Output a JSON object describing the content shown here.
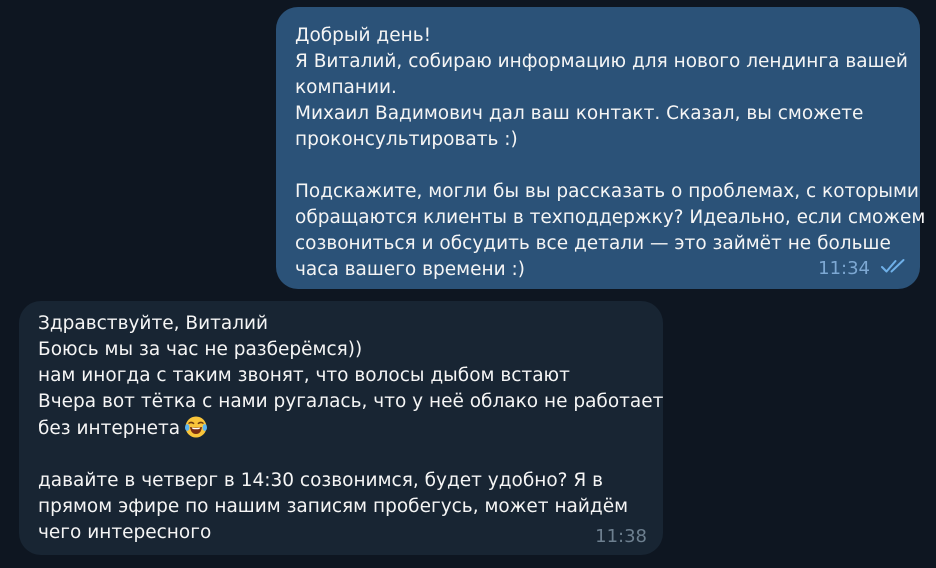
{
  "outgoing_message": {
    "lines": [
      "Добрый день!",
      "Я Виталий, собираю информацию для нового лендинга вашей",
      "компании.",
      "Михаил Вадимович дал ваш контакт. Сказал, вы сможете",
      "проконсультировать :)",
      "",
      "Подскажите, могли бы вы рассказать о проблемах, с которыми",
      "обращаются клиенты в техподдержку? Идеально, если сможем",
      "созвониться и обсудить все детали — это займёт не больше",
      "часа вашего времени :)"
    ],
    "time": "11:34",
    "status_icon": "double-check-icon"
  },
  "incoming_message": {
    "lines": [
      "Здравствуйте, Виталий",
      "Боюсь мы за час не разберёмся))",
      "нам иногда с таким звонят, что волосы дыбом встают",
      "Вчера вот тётка с нами ругалась, что у неё облако не работает",
      "без интернета",
      "",
      "давайте в четверг в 14:30 созвонимся, будет удобно? Я в",
      "прямом эфире по нашим записям пробегусь, может найдём",
      "чего интересного"
    ],
    "emoji_icon": "laughing-tears-emoji-icon",
    "time": "11:38"
  },
  "colors": {
    "background": "#0e1621",
    "outgoing_bubble": "#2b5278",
    "incoming_bubble": "#182533",
    "text": "#f5f5f5",
    "outgoing_meta": "#7da8d3",
    "incoming_meta": "#6d7f8f"
  }
}
